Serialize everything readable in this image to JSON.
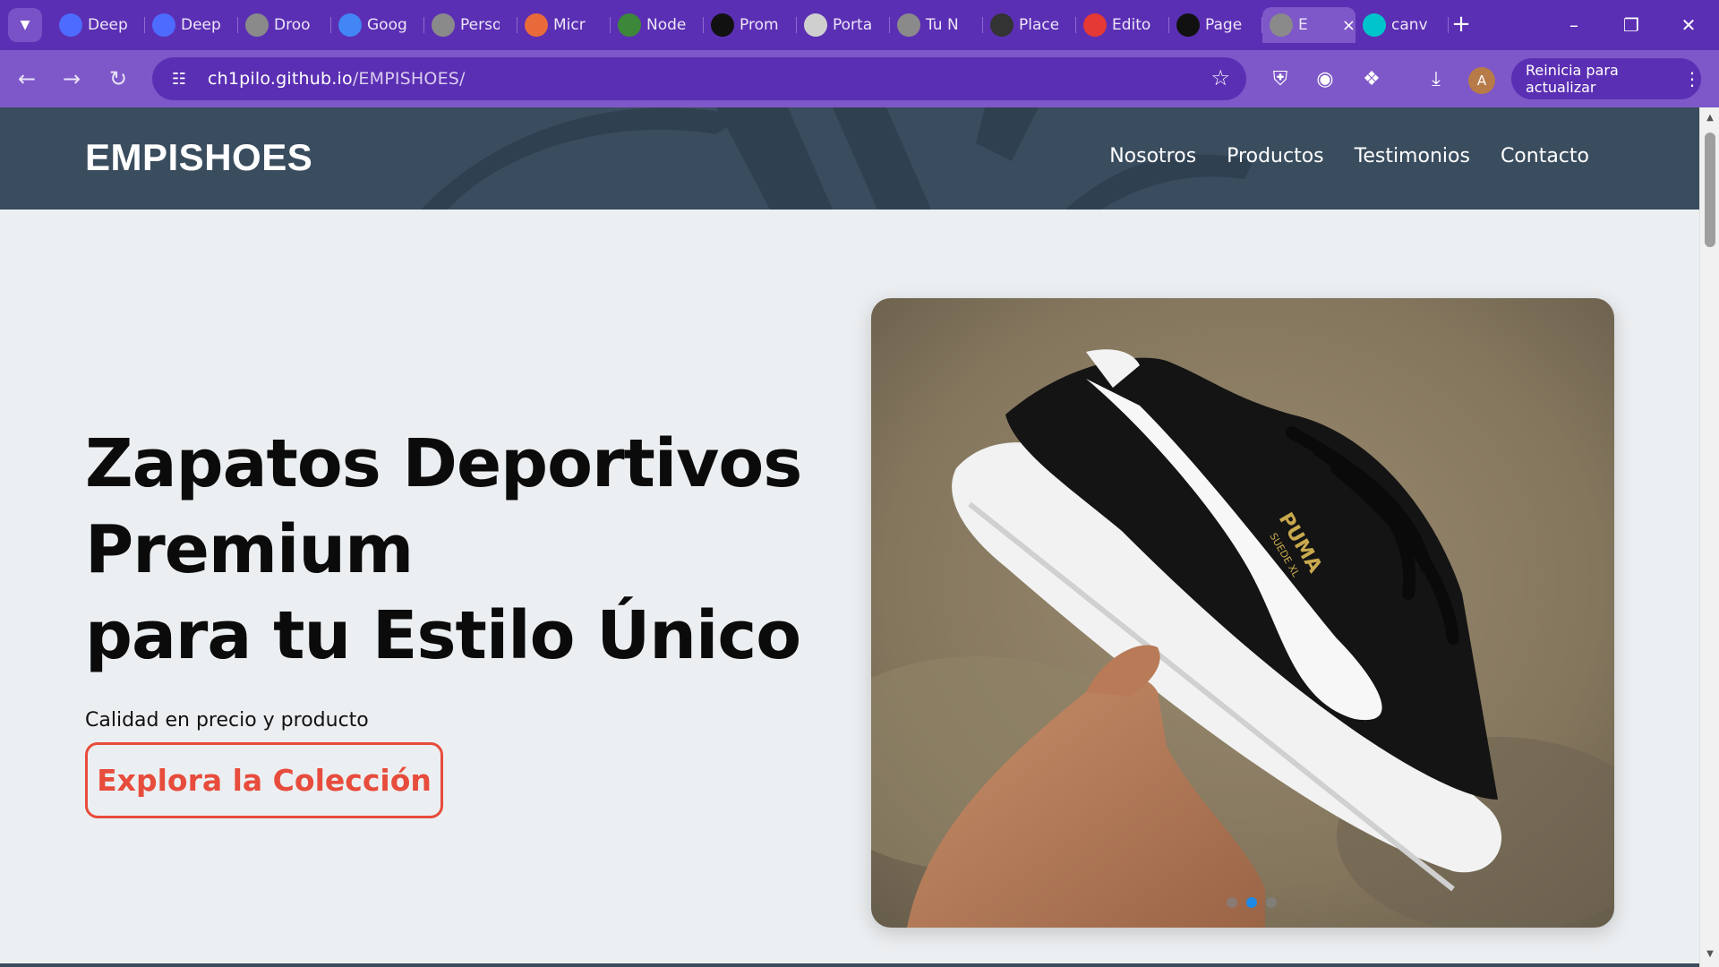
{
  "browser": {
    "tabs": [
      {
        "title": "Deep",
        "icon": "deepseek-icon",
        "color": "#4d6bfe"
      },
      {
        "title": "Deep",
        "icon": "deepseek-icon",
        "color": "#4d6bfe"
      },
      {
        "title": "Droo",
        "icon": "globe-icon",
        "color": "#8a8a8a"
      },
      {
        "title": "Goog",
        "icon": "sparkle-icon",
        "color": "#4285f4"
      },
      {
        "title": "Perso",
        "icon": "globe-icon",
        "color": "#8a8a8a"
      },
      {
        "title": "Micr",
        "icon": "copilot-icon",
        "color": "#e86a3a"
      },
      {
        "title": "Node",
        "icon": "nodejs-icon",
        "color": "#3c873a"
      },
      {
        "title": "Prom",
        "icon": "openai-icon",
        "color": "#111111"
      },
      {
        "title": "Porta",
        "icon": "portal-icon",
        "color": "#cfcfcf"
      },
      {
        "title": "Tu N",
        "icon": "globe-icon",
        "color": "#8a8a8a"
      },
      {
        "title": "Place",
        "icon": "placeholder-icon",
        "color": "#333333"
      },
      {
        "title": "Edito",
        "icon": "p-editor-icon",
        "color": "#e53935"
      },
      {
        "title": "Page",
        "icon": "github-icon",
        "color": "#111111"
      },
      {
        "title": "E",
        "icon": "globe-icon",
        "color": "#8a8a8a",
        "active": true
      },
      {
        "title": "canv",
        "icon": "canva-icon",
        "color": "#00c4cc"
      }
    ],
    "url_host": "ch1pilo.github.io",
    "url_path": "/EMPISHOES/",
    "avatar_letter": "A",
    "update_label": "Reinicia para actualizar",
    "accent": "#5b2fb3"
  },
  "site": {
    "brand": "EMPISHOES",
    "nav": [
      "Nosotros",
      "Productos",
      "Testimonios",
      "Contacto"
    ],
    "hero": {
      "title_lines": [
        "Zapatos Deportivos",
        "Premium",
        "para tu Estilo Único"
      ],
      "subtitle": "Calidad en precio y producto",
      "cta": "Explora la Colección"
    },
    "carousel": {
      "image": "puma-suede-sneaker-in-hand",
      "slides": 3,
      "active_slide": 2
    },
    "colors": {
      "header_bg": "#3a4d5f",
      "cta": "#e74c3c",
      "page_bg": "#eceff1",
      "active_dot": "#1e88e5"
    }
  }
}
